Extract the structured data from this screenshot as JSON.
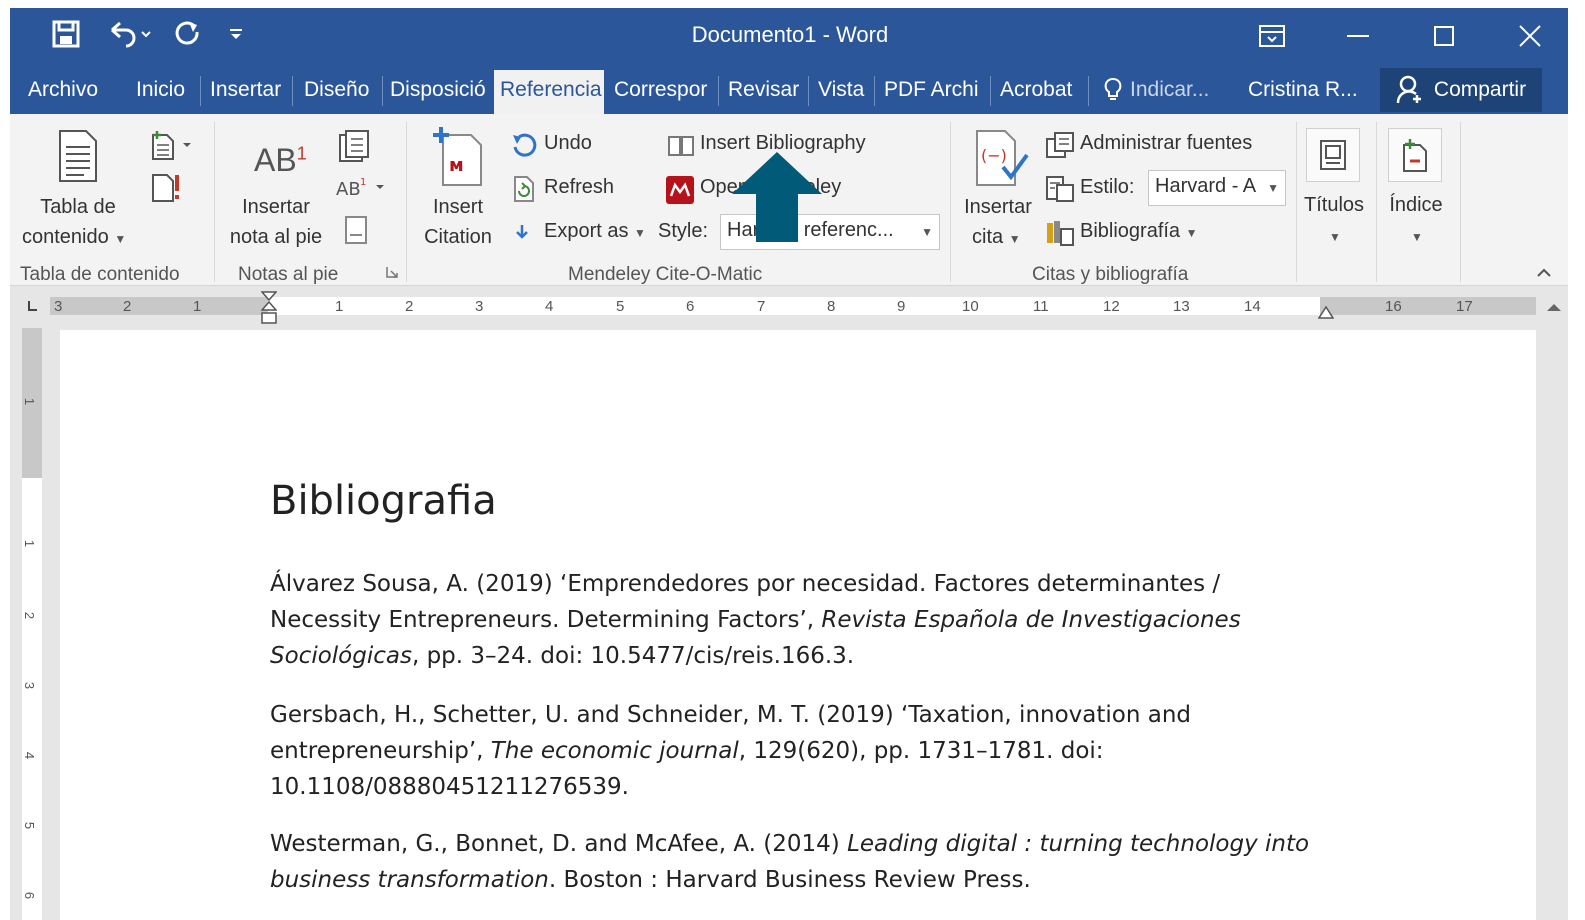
{
  "window": {
    "title": "Documento1 - Word",
    "qat": [
      "save-icon",
      "undo-icon",
      "redo-icon",
      "customize-icon"
    ]
  },
  "tabs": [
    "Archivo",
    "Inicio",
    "Insertar",
    "Diseño",
    "Disposició",
    "Referencia",
    "Correspor",
    "Revisar",
    "Vista",
    "PDF Archi",
    "Acrobat"
  ],
  "active_tab": "Referencia",
  "tell_me": "Indicar...",
  "user": "Cristina R...",
  "share": "Compartir",
  "ribbon": {
    "toc": {
      "label1": "Tabla de",
      "label2": "contenido",
      "group": "Tabla de contenido"
    },
    "footnotes": {
      "label1": "Insertar",
      "label2": "nota al pie",
      "group": "Notas al pie",
      "ab": "AB",
      "sup": "1"
    },
    "mendeley": {
      "insert_citation1": "Insert",
      "insert_citation2": "Citation",
      "undo": "Undo",
      "refresh": "Refresh",
      "export": "Export as",
      "insert_bibliography": "Insert Bibliography",
      "open_mendeley": "Open Mendeley",
      "style_label": "Style:",
      "style_value": "Harvard referenc...",
      "group": "Mendeley Cite-O-Matic"
    },
    "citations": {
      "insert_cite1": "Insertar",
      "insert_cite2": "cita",
      "manage_sources": "Administrar fuentes",
      "style_label": "Estilo:",
      "style_value": "Harvard - A",
      "bibliography": "Bibliografía",
      "group": "Citas y bibliografía"
    },
    "titles": "Títulos",
    "index": "Índice"
  },
  "ruler": {
    "left_numbers": [
      "3",
      "2",
      "1"
    ],
    "right_numbers": [
      "1",
      "2",
      "3",
      "4",
      "5",
      "6",
      "7",
      "8",
      "9",
      "10",
      "11",
      "12",
      "13",
      "14",
      "16",
      "17"
    ],
    "vertical_numbers": [
      "1",
      "1",
      "2",
      "3",
      "4",
      "5",
      "6"
    ]
  },
  "document": {
    "heading": "Bibliografia",
    "refs": [
      {
        "pre": "Álvarez Sousa, A. (2019) ‘Emprendedores por necesidad. Factores determinantes / Necessity Entrepreneurs. Determining Factors’, ",
        "ital": "Revista Española de Investigaciones Sociológicas",
        "post": ", pp. 3–24. doi: 10.5477/cis/reis.166.3."
      },
      {
        "pre": "Gersbach, H., Schetter, U. and Schneider, M. T. (2019) ‘Taxation, innovation and entrepreneurship’, ",
        "ital": "The economic journal",
        "post": ", 129(620), pp. 1731–1781. doi: 10.1108/08880451211276539."
      },
      {
        "pre": "Westerman, G., Bonnet, D. and McAfee, A. (2014) ",
        "ital": "Leading digital : turning technology into business transformation",
        "post": ". Boston : Harvard Business Review Press."
      }
    ]
  },
  "colors": {
    "word_blue": "#2b579a",
    "arrow": "#005a78",
    "mendeley_red": "#b6121b"
  }
}
